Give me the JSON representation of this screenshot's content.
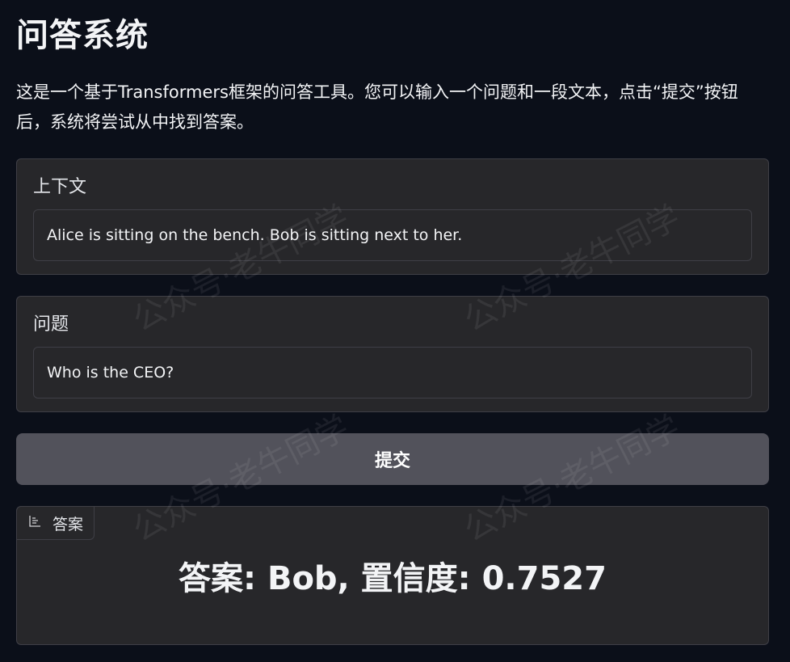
{
  "header": {
    "title": "问答系统",
    "description": "这是一个基于Transformers框架的问答工具。您可以输入一个问题和一段文本，点击“提交”按钮后，系统将尝试从中找到答案。"
  },
  "context_block": {
    "label": "上下文",
    "value": "Alice is sitting on the bench. Bob is sitting next to her."
  },
  "question_block": {
    "label": "问题",
    "value": "Who is the CEO?"
  },
  "submit_label": "提交",
  "output": {
    "tab_label": "答案",
    "tab_icon": "chart-icon",
    "result": "答案: Bob, 置信度: 0.7527"
  },
  "watermark": "公众号·老牛同学"
}
